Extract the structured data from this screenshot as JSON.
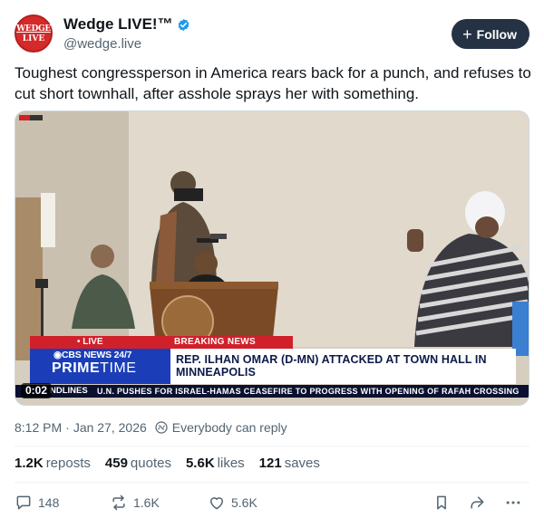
{
  "author": {
    "avatar_line1": "WEDGE",
    "avatar_line2": "LIVE",
    "display_name": "Wedge LIVE!™",
    "handle": "@wedge.live",
    "verified": true
  },
  "follow_label": "Follow",
  "post_text": "Toughest congressperson in America rears back for a punch, and refuses to cut short townhall, after asshole sprays her with something.",
  "video": {
    "timestamp": "0:02",
    "chyron": {
      "live_tab": "• LIVE",
      "breaking_tab": "BREAKING NEWS",
      "network": "◉CBS NEWS 24/7",
      "show_bold": "PRIME",
      "show_light": "TIME",
      "headline_line1": "REP. ILHAN OMAR (D-MN) ATTACKED AT TOWN HALL IN",
      "headline_line2": "MINNEAPOLIS",
      "ticker_label": "NDLINES",
      "ticker_text": "U.N. PUSHES FOR ISRAEL-HAMAS CEASEFIRE TO PROGRESS WITH OPENING OF RAFAH CROSSING"
    }
  },
  "meta": {
    "time": "8:12 PM",
    "separator": "·",
    "date": "Jan 27, 2026",
    "reply_setting": "Everybody can reply"
  },
  "stats": [
    {
      "value": "1.2K",
      "label": "reposts"
    },
    {
      "value": "459",
      "label": "quotes"
    },
    {
      "value": "5.6K",
      "label": "likes"
    },
    {
      "value": "121",
      "label": "saves"
    }
  ],
  "actions": {
    "replies": "148",
    "reposts": "1.6K",
    "likes": "5.6K"
  },
  "colors": {
    "follow_bg": "#243244",
    "verified": "#1d9bf0",
    "avatar_red": "#d42a2a",
    "muted_text": "#536471"
  }
}
